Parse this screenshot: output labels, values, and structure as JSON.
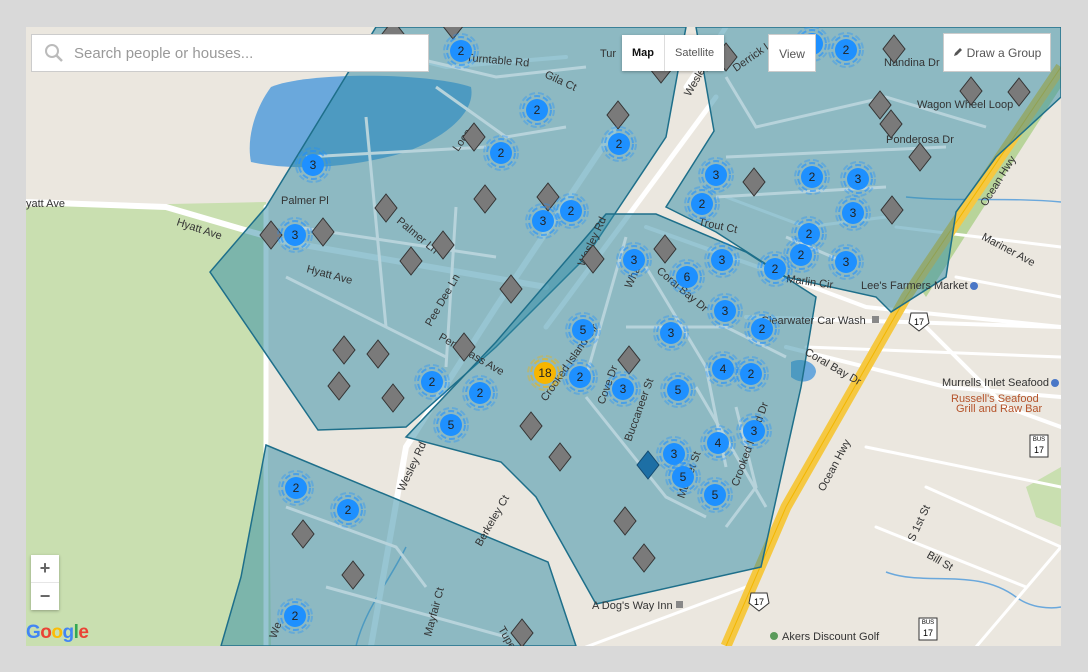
{
  "search": {
    "placeholder": "Search people or houses..."
  },
  "map_type": {
    "map_label": "Map",
    "satellite_label": "Satellite"
  },
  "view_label": "View",
  "draw_group_label": "Draw a Group",
  "zoom": {
    "in_label": "+",
    "out_label": "−"
  },
  "logo": {
    "g1": "G",
    "o1": "o",
    "o2": "o",
    "g2": "g",
    "l": "l",
    "e": "e"
  },
  "colors": {
    "cluster_blue": "#1e90ff",
    "cluster_orange": "#f7b500",
    "group_fill": "#2f8ca6",
    "house_marker": "#7a7a7a",
    "house_selected": "#1d6fa5"
  },
  "road_labels": {
    "turntable_rd": "Turntable Rd",
    "gila_ct": "Gila Ct",
    "tur": "Tur",
    "derrick_ln": "Derrick Ln",
    "wesley_top": "Wesley",
    "nandina_dr": "Nandina Dr",
    "wagon_wheel_loop": "Wagon Wheel Loop",
    "ponderosa_dr": "Ponderosa Dr",
    "loop": "Loop",
    "hyatt_ave_left": "yatt Ave",
    "hyatt_ave_diag": "Hyatt Ave",
    "palmer_pl": "Palmer Pl",
    "palmer_ln": "Palmer Ln",
    "hyatt_ave_2": "Hyatt Ave",
    "pee_dee_ln": "Pee Dee Ln",
    "pen_grass_ave": "Pen    Grass Ave",
    "wesley_rd_mid": "Wesley Rd",
    "whaler": "Whaler",
    "coral_bay_dr": "Coral Bay Dr",
    "trout_ct": "Trout Ct",
    "marlin_cir": "Marlin Cir",
    "clearwater": "Clearwater Car Wash",
    "crooked_island_cir": "Crooked Island Cir",
    "buccaneer_st": "Buccaneer St",
    "cove_dr": "Cove Dr",
    "musket_st": "Musket St",
    "crooked_island_dr": "Crooked Island Dr",
    "coral_bay_dr_2": "Coral Bay Dr",
    "ocean_hwy_top": "Ocean Hwy",
    "mariner_ave": "Mariner Ave",
    "ocean_hwy": "Ocean Hwy",
    "wesley_rd_low": "Wesley Rd",
    "berkeley_ct": "Berkeley Ct",
    "mayfair_ct": "Mayfair Ct",
    "tupelo": "Tupe",
    "we": "We",
    "s_1st_st": "S 1st St",
    "bill_st": "Bill St"
  },
  "pois": {
    "lees": "Lee's Farmers Market",
    "clearwater": "Clearwater Car Wash",
    "murrells": "Murrells Inlet Seafood",
    "russells_1": "Russell's Seafood",
    "russells_2": "Grill and Raw Bar",
    "dogs_way": "A Dog's Way Inn",
    "akers": "Akers Discount Golf"
  },
  "route_shields": {
    "us17_a": "17",
    "us17_b": "17",
    "bus17_a": "17",
    "bus17_b": "17",
    "bus": "BUS"
  },
  "clusters": [
    {
      "id": "c1",
      "n": "2"
    },
    {
      "id": "c2",
      "n": "2"
    },
    {
      "id": "c3",
      "n": "2"
    },
    {
      "id": "c4",
      "n": "2"
    },
    {
      "id": "c5",
      "n": "2"
    },
    {
      "id": "c6",
      "n": "3"
    },
    {
      "id": "c7",
      "n": "2"
    },
    {
      "id": "c8",
      "n": "3"
    },
    {
      "id": "c9",
      "n": "2"
    },
    {
      "id": "c10",
      "n": "3"
    },
    {
      "id": "c11",
      "n": "3"
    },
    {
      "id": "c12",
      "n": "2"
    },
    {
      "id": "c13",
      "n": "3"
    },
    {
      "id": "c14",
      "n": "2"
    },
    {
      "id": "c15",
      "n": "3"
    },
    {
      "id": "c16",
      "n": "2"
    },
    {
      "id": "c17",
      "n": "3"
    },
    {
      "id": "c18",
      "n": "6"
    },
    {
      "id": "c19",
      "n": "3"
    },
    {
      "id": "c20",
      "n": "2"
    },
    {
      "id": "c21",
      "n": "3"
    },
    {
      "id": "c22",
      "n": "5"
    },
    {
      "id": "c23",
      "n": "3"
    },
    {
      "id": "c24",
      "n": "3"
    },
    {
      "id": "c25",
      "n": "2"
    },
    {
      "id": "c26",
      "n": "18"
    },
    {
      "id": "c27",
      "n": "2"
    },
    {
      "id": "c28",
      "n": "3"
    },
    {
      "id": "c29",
      "n": "5"
    },
    {
      "id": "c30",
      "n": "4"
    },
    {
      "id": "c31",
      "n": "2"
    },
    {
      "id": "c32",
      "n": "2"
    },
    {
      "id": "c33",
      "n": "2"
    },
    {
      "id": "c34",
      "n": "5"
    },
    {
      "id": "c35",
      "n": "3"
    },
    {
      "id": "c36",
      "n": "4"
    },
    {
      "id": "c37",
      "n": "3"
    },
    {
      "id": "c38",
      "n": "5"
    },
    {
      "id": "c39",
      "n": "5"
    },
    {
      "id": "c40",
      "n": "2"
    },
    {
      "id": "c41",
      "n": "2"
    },
    {
      "id": "c42",
      "n": "2"
    },
    {
      "id": "c43",
      "n": "2"
    }
  ]
}
